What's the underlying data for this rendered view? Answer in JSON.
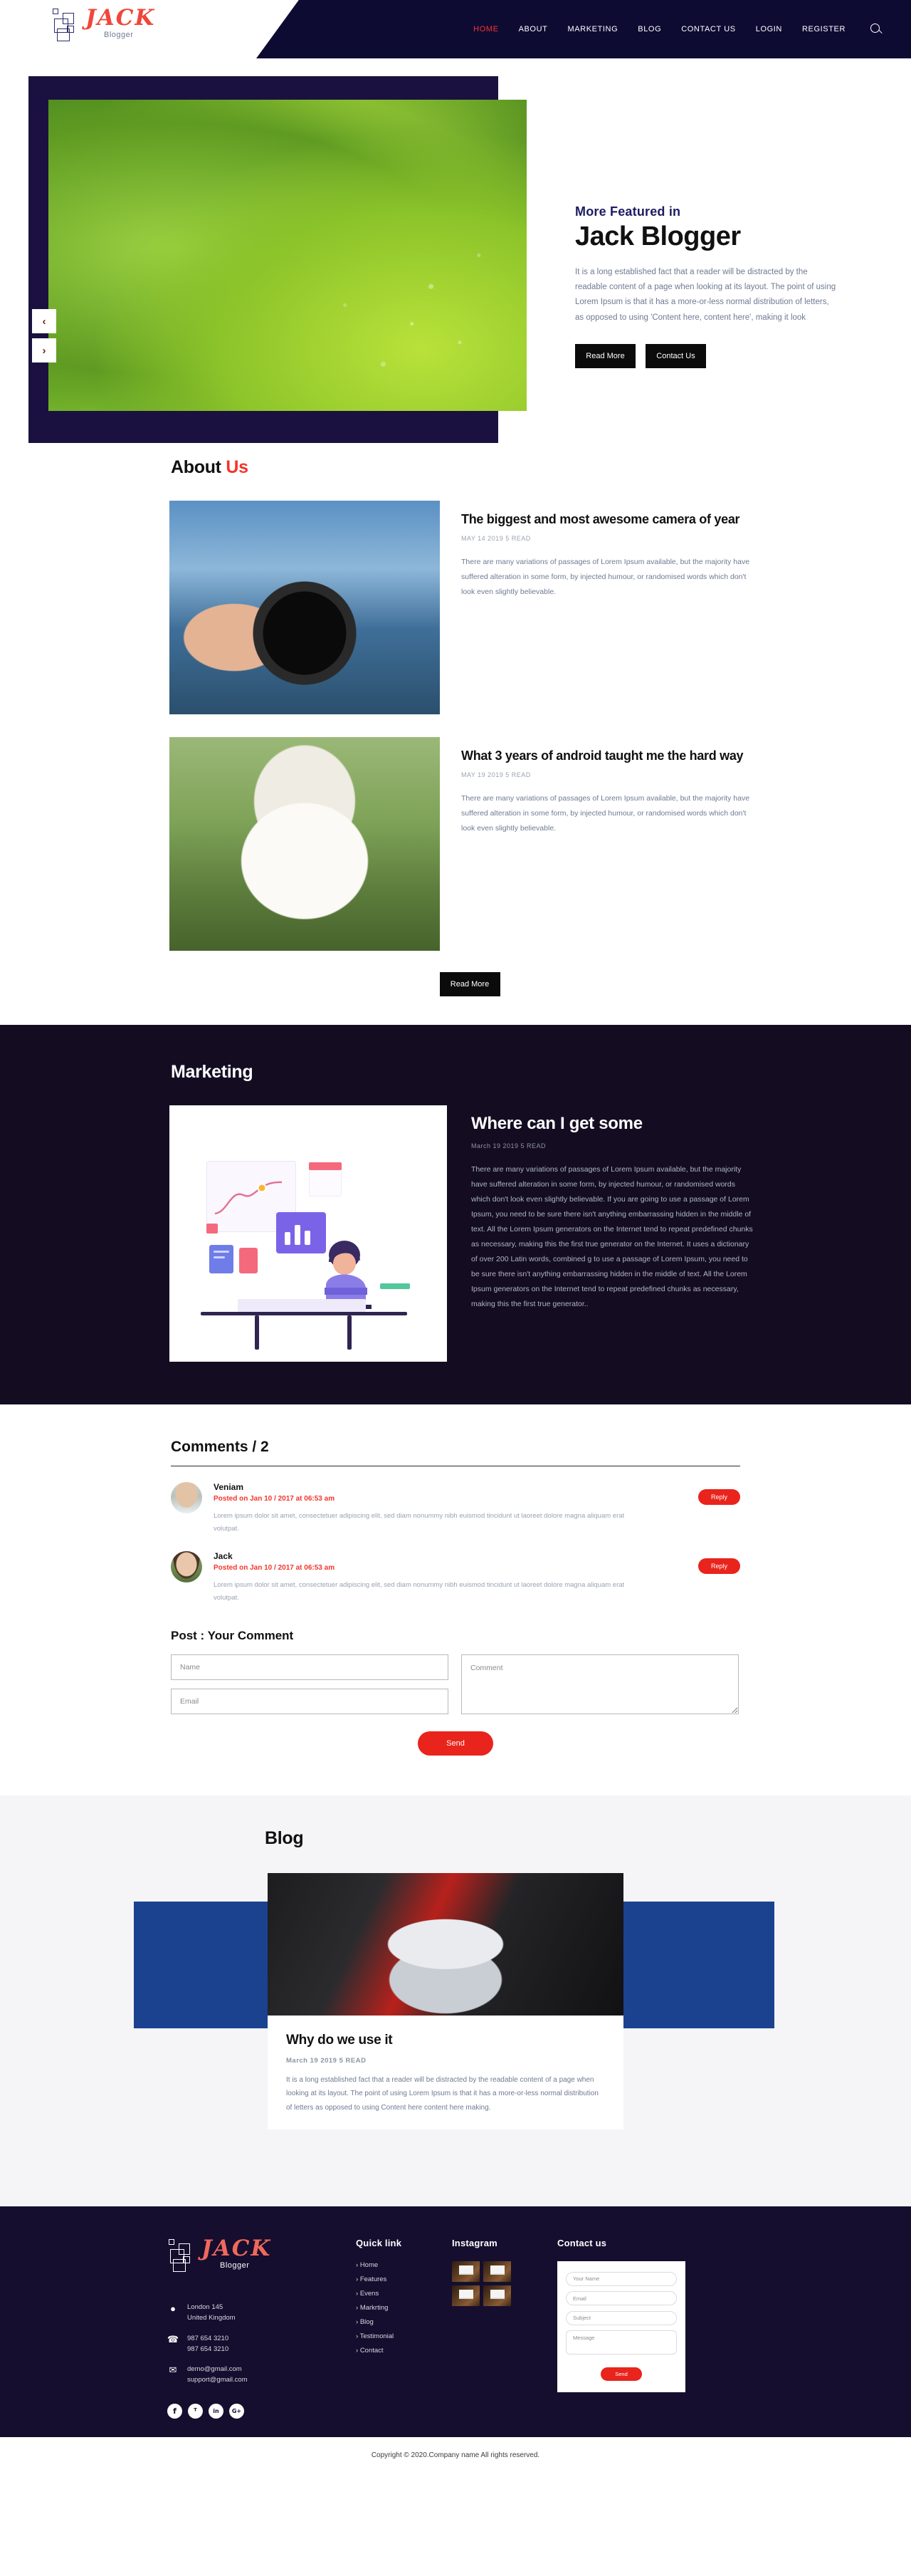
{
  "brand": {
    "name": "JACK",
    "tagline": "Blogger"
  },
  "nav": {
    "items": [
      {
        "label": "HOME",
        "active": true
      },
      {
        "label": "ABOUT",
        "active": false
      },
      {
        "label": "MARKETING",
        "active": false
      },
      {
        "label": "BLOG",
        "active": false
      },
      {
        "label": "CONTACT US",
        "active": false
      },
      {
        "label": "LOGIN",
        "active": false
      },
      {
        "label": "REGISTER",
        "active": false
      }
    ],
    "search_icon": "search-icon"
  },
  "hero": {
    "eyebrow": "More Featured in",
    "title": "Jack Blogger",
    "copy": "It is a long established fact that a reader will be distracted by the readable content of a page when looking at its layout. The point of using Lorem Ipsum is that it has a more-or-less normal distribution of letters, as opposed to using 'Content here, content here', making it look",
    "btn_read": "Read More",
    "btn_contact": "Contact Us",
    "prev": "‹",
    "next": "›"
  },
  "about": {
    "title_main": "About",
    "title_accent": "Us",
    "read_more": "Read More",
    "posts": [
      {
        "title": "The biggest and most awesome camera of year",
        "meta": "MAY 14 2019 5 READ",
        "copy": "There are many variations of passages of Lorem Ipsum available, but the majority have suffered alteration in some form, by injected humour, or randomised words which don't look even slightly believable."
      },
      {
        "title": "What 3 years of android taught me the hard way",
        "meta": "MAY 19 2019 5 READ",
        "copy": "There are many variations of passages of Lorem Ipsum available, but the majority have suffered alteration in some form, by injected humour, or randomised words which don't look even slightly believable."
      }
    ]
  },
  "marketing": {
    "title": "Marketing",
    "post": {
      "title": "Where can I get some",
      "meta": "March 19 2019 5 READ",
      "copy": "There are many variations of passages of Lorem Ipsum available, but the majority have suffered alteration in some form, by injected humour, or randomised words which don't look even slightly believable. If you are going to use a passage of Lorem Ipsum, you need to be sure there isn't anything embarrassing hidden in the middle of text. All the Lorem Ipsum generators on the Internet tend to repeat predefined chunks as necessary, making this the first true generator on the Internet. It uses a dictionary of over 200 Latin words, combined g to use a passage of Lorem Ipsum, you need to be sure there isn't anything embarrassing hidden in the middle of text. All the Lorem Ipsum generators on the Internet tend to repeat predefined chunks as necessary, making this the first true generator.."
    }
  },
  "comments": {
    "heading": "Comments / 2",
    "items": [
      {
        "name": "Veniam",
        "date": "Posted on Jan 10 / 2017 at 06:53 am",
        "text": "Lorem ipsum dolor sit amet, consectetuer adipiscing elit, sed diam nonummy nibh euismod tincidunt ut laoreet dolore magna aliquam erat volutpat.",
        "reply": "Reply"
      },
      {
        "name": "Jack",
        "date": "Posted on Jan 10 / 2017 at 06:53 am",
        "text": "Lorem ipsum dolor sit amet, consectetuer adipiscing elit, sed diam nonummy nibh euismod tincidunt ut laoreet dolore magna aliquam erat volutpat.",
        "reply": "Reply"
      }
    ],
    "form": {
      "heading": "Post : Your Comment",
      "name_placeholder": "Name",
      "email_placeholder": "Email",
      "comment_placeholder": "Comment",
      "send_label": "Send"
    }
  },
  "blog": {
    "title": "Blog",
    "post": {
      "title": "Why do we use it",
      "meta": "March 19 2019 5 READ",
      "copy": "It is a long established fact that a reader will be distracted by the readable content of a page when looking at its layout. The point of using Lorem Ipsum is that it has a more-or-less normal distribution of letters as opposed to using Content here content here making."
    }
  },
  "footer": {
    "address": "London 145\nUnited Kingdom",
    "phone1": "987 654 3210",
    "phone2": "987 654 3210",
    "email1": "demo@gmail.com",
    "email2": "support@gmail.com",
    "socials": [
      {
        "name": "facebook-icon",
        "glyph": "f"
      },
      {
        "name": "twitter-icon",
        "glyph": "ᵀ"
      },
      {
        "name": "linkedin-icon",
        "glyph": "in"
      },
      {
        "name": "google-plus-icon",
        "glyph": "G+"
      }
    ],
    "quick_link": {
      "title": "Quick link",
      "items": [
        "Home",
        "Features",
        "Evens",
        "Markrting",
        "Blog",
        "Testimonial",
        "Contact"
      ]
    },
    "instagram": {
      "title": "Instagram",
      "count": 4
    },
    "contact": {
      "title": "Contact us",
      "name_placeholder": "Your Name",
      "email_placeholder": "Email",
      "subject_placeholder": "Subject",
      "message_placeholder": "Message",
      "send_label": "Send"
    },
    "copyright": "Copyright © 2020.Company name All rights reserved."
  },
  "colors": {
    "nav_dark": "#0e0b33",
    "hero_dark": "#1b1140",
    "marketing_dark": "#140d22",
    "footer_dark": "#150e2e",
    "accent_red": "#f5342b",
    "button_red": "#e8241c",
    "blog_blue": "#1a428f",
    "brand_red": "#f0463a"
  }
}
